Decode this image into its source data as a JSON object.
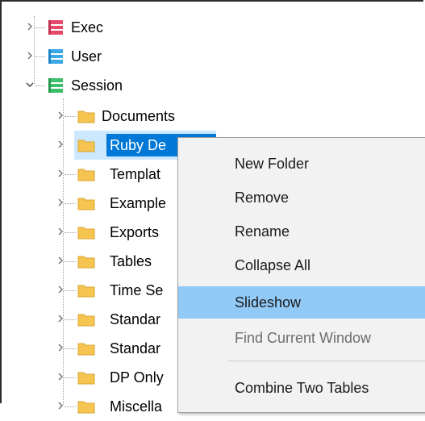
{
  "tree": {
    "roots": [
      {
        "label": "Exec",
        "icon": "database-icon",
        "color": "#e64a6b",
        "expanded": false
      },
      {
        "label": "User",
        "icon": "database-icon",
        "color": "#3aa8e8",
        "expanded": false
      },
      {
        "label": "Session",
        "icon": "database-icon",
        "color": "#3cc06a",
        "expanded": true
      }
    ],
    "children": [
      {
        "label": "Documents"
      },
      {
        "label": "Ruby De",
        "selected": true
      },
      {
        "label": "Templat"
      },
      {
        "label": "Example"
      },
      {
        "label": "Exports"
      },
      {
        "label": "Tables"
      },
      {
        "label": "Time Se"
      },
      {
        "label": "Standar"
      },
      {
        "label": "Standar"
      },
      {
        "label": "DP Only"
      },
      {
        "label": "Miscella"
      }
    ]
  },
  "context_menu": {
    "items": [
      {
        "label": "New Folder",
        "state": "normal"
      },
      {
        "label": "Remove",
        "state": "normal"
      },
      {
        "label": "Rename",
        "state": "normal"
      },
      {
        "label": "Collapse All",
        "state": "normal"
      },
      {
        "label": "Slideshow",
        "state": "highlighted"
      },
      {
        "label": "Find Current Window",
        "state": "disabled"
      },
      {
        "label": "Combine Two Tables",
        "state": "normal"
      }
    ]
  },
  "colors": {
    "selection": "#0078d7",
    "menu_highlight": "#91c9f7",
    "folder": "#f5c451"
  }
}
